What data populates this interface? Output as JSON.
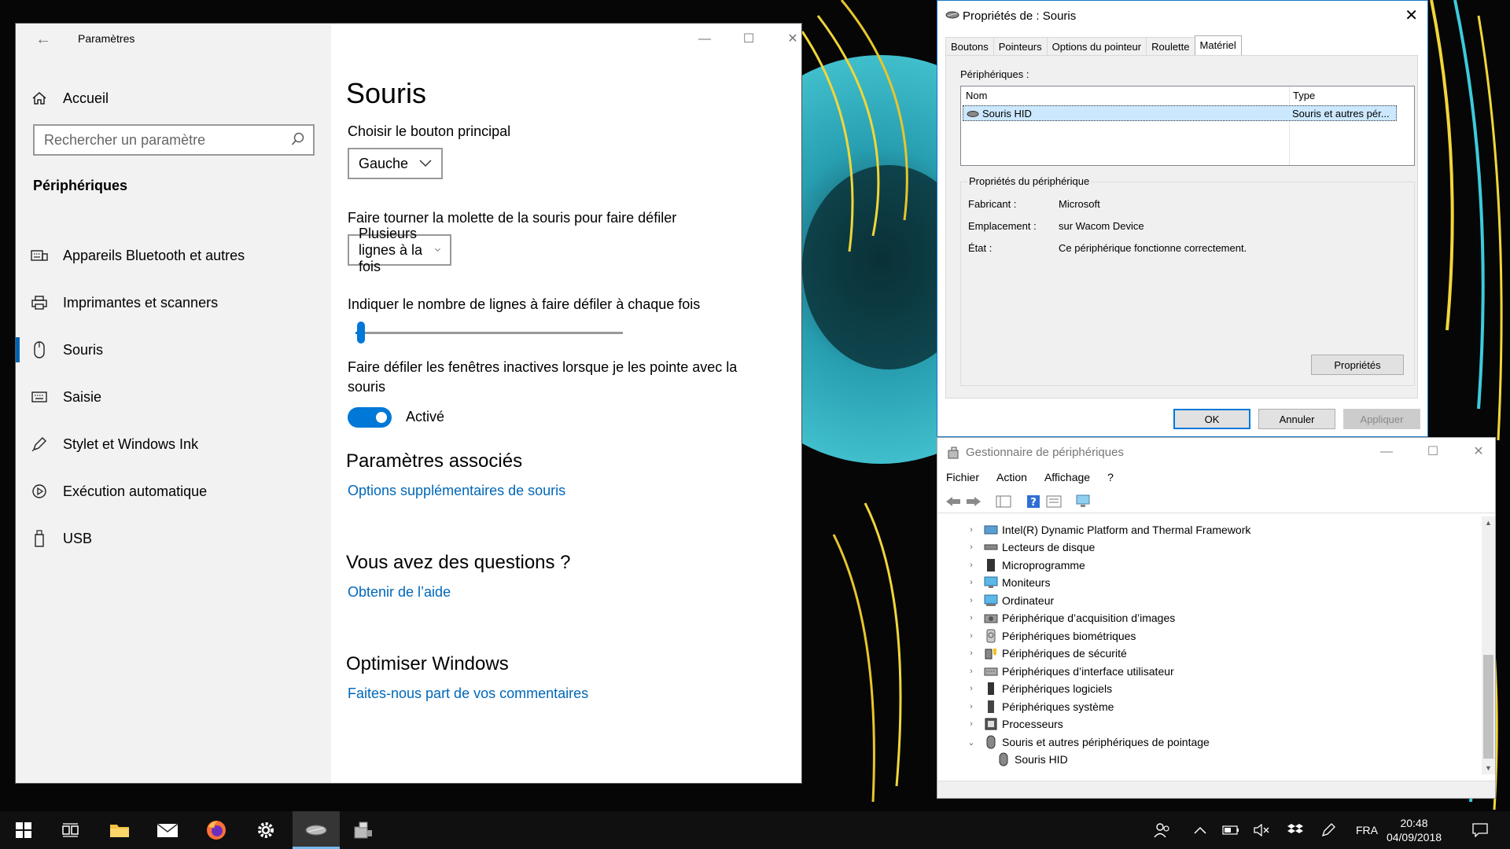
{
  "settings": {
    "window_title": "Paramètres",
    "nav": {
      "home": "Accueil",
      "search_placeholder": "Rechercher un paramètre",
      "section": "Périphériques",
      "items": [
        {
          "label": "Appareils Bluetooth et autres",
          "icon": "keyboard-icon"
        },
        {
          "label": "Imprimantes et scanners",
          "icon": "printer-icon"
        },
        {
          "label": "Souris",
          "icon": "mouse-icon"
        },
        {
          "label": "Saisie",
          "icon": "keyboard-icon"
        },
        {
          "label": "Stylet et Windows Ink",
          "icon": "pen-icon"
        },
        {
          "label": "Exécution automatique",
          "icon": "autoplay-icon"
        },
        {
          "label": "USB",
          "icon": "usb-icon"
        }
      ]
    },
    "content": {
      "title": "Souris",
      "primary_button_label": "Choisir le bouton principal",
      "primary_button_value": "Gauche",
      "scroll_label": "Faire tourner la molette de la souris pour faire défiler",
      "scroll_value": "Plusieurs lignes à la fois",
      "lines_label": "Indiquer le nombre de lignes à faire défiler à chaque fois",
      "lines_slider_fraction": 0.02,
      "inactive_label_line1": "Faire défiler les fenêtres inactives lorsque je les pointe avec la",
      "inactive_label_line2": "souris",
      "inactive_toggle_label": "Activé",
      "related_heading": "Paramètres associés",
      "related_link": "Options supplémentaires de souris",
      "questions_heading": "Vous avez des questions ?",
      "questions_link": "Obtenir de l’aide",
      "optimize_heading": "Optimiser Windows",
      "optimize_link": "Faites-nous part de vos commentaires"
    }
  },
  "props": {
    "title": "Propriétés de : Souris",
    "tabs": [
      "Boutons",
      "Pointeurs",
      "Options du pointeur",
      "Roulette",
      "Matériel"
    ],
    "devices_label": "Périphériques :",
    "columns": [
      "Nom",
      "Type"
    ],
    "row": {
      "name": "Souris HID",
      "type": "Souris et autres pér..."
    },
    "group_title": "Propriétés du périphérique",
    "fields": [
      {
        "key": "Fabricant :",
        "value": "Microsoft"
      },
      {
        "key": "Emplacement :",
        "value": "sur Wacom Device"
      },
      {
        "key": "État :",
        "value": "Ce périphérique fonctionne correctement."
      }
    ],
    "properties_button": "Propriétés",
    "ok": "OK",
    "cancel": "Annuler",
    "apply": "Appliquer"
  },
  "devmgr": {
    "title": "Gestionnaire de périphériques",
    "menu": [
      "Fichier",
      "Action",
      "Affichage",
      "?"
    ],
    "tree": [
      {
        "label": "Intel(R) Dynamic Platform and Thermal Framework",
        "icon": "chip-icon"
      },
      {
        "label": "Lecteurs de disque",
        "icon": "disk-icon"
      },
      {
        "label": "Microprogramme",
        "icon": "firmware-icon"
      },
      {
        "label": "Moniteurs",
        "icon": "monitor-icon"
      },
      {
        "label": "Ordinateur",
        "icon": "computer-icon"
      },
      {
        "label": "Périphérique d’acquisition d’images",
        "icon": "camera-icon"
      },
      {
        "label": "Périphériques biométriques",
        "icon": "biometric-icon"
      },
      {
        "label": "Périphériques de sécurité",
        "icon": "security-icon"
      },
      {
        "label": "Périphériques d’interface utilisateur",
        "icon": "hid-icon"
      },
      {
        "label": "Périphériques logiciels",
        "icon": "software-device-icon"
      },
      {
        "label": "Périphériques système",
        "icon": "system-device-icon"
      },
      {
        "label": "Processeurs",
        "icon": "processor-icon"
      },
      {
        "label": "Souris et autres périphériques de pointage",
        "icon": "mouse-icon"
      }
    ],
    "child": {
      "label": "Souris HID",
      "icon": "mouse-icon"
    }
  },
  "taskbar": {
    "lang": "FRA",
    "time": "20:48",
    "date": "04/09/2018"
  },
  "colors": {
    "accent": "#0078d7",
    "link": "#0067b8",
    "taskbar": "#101010"
  }
}
